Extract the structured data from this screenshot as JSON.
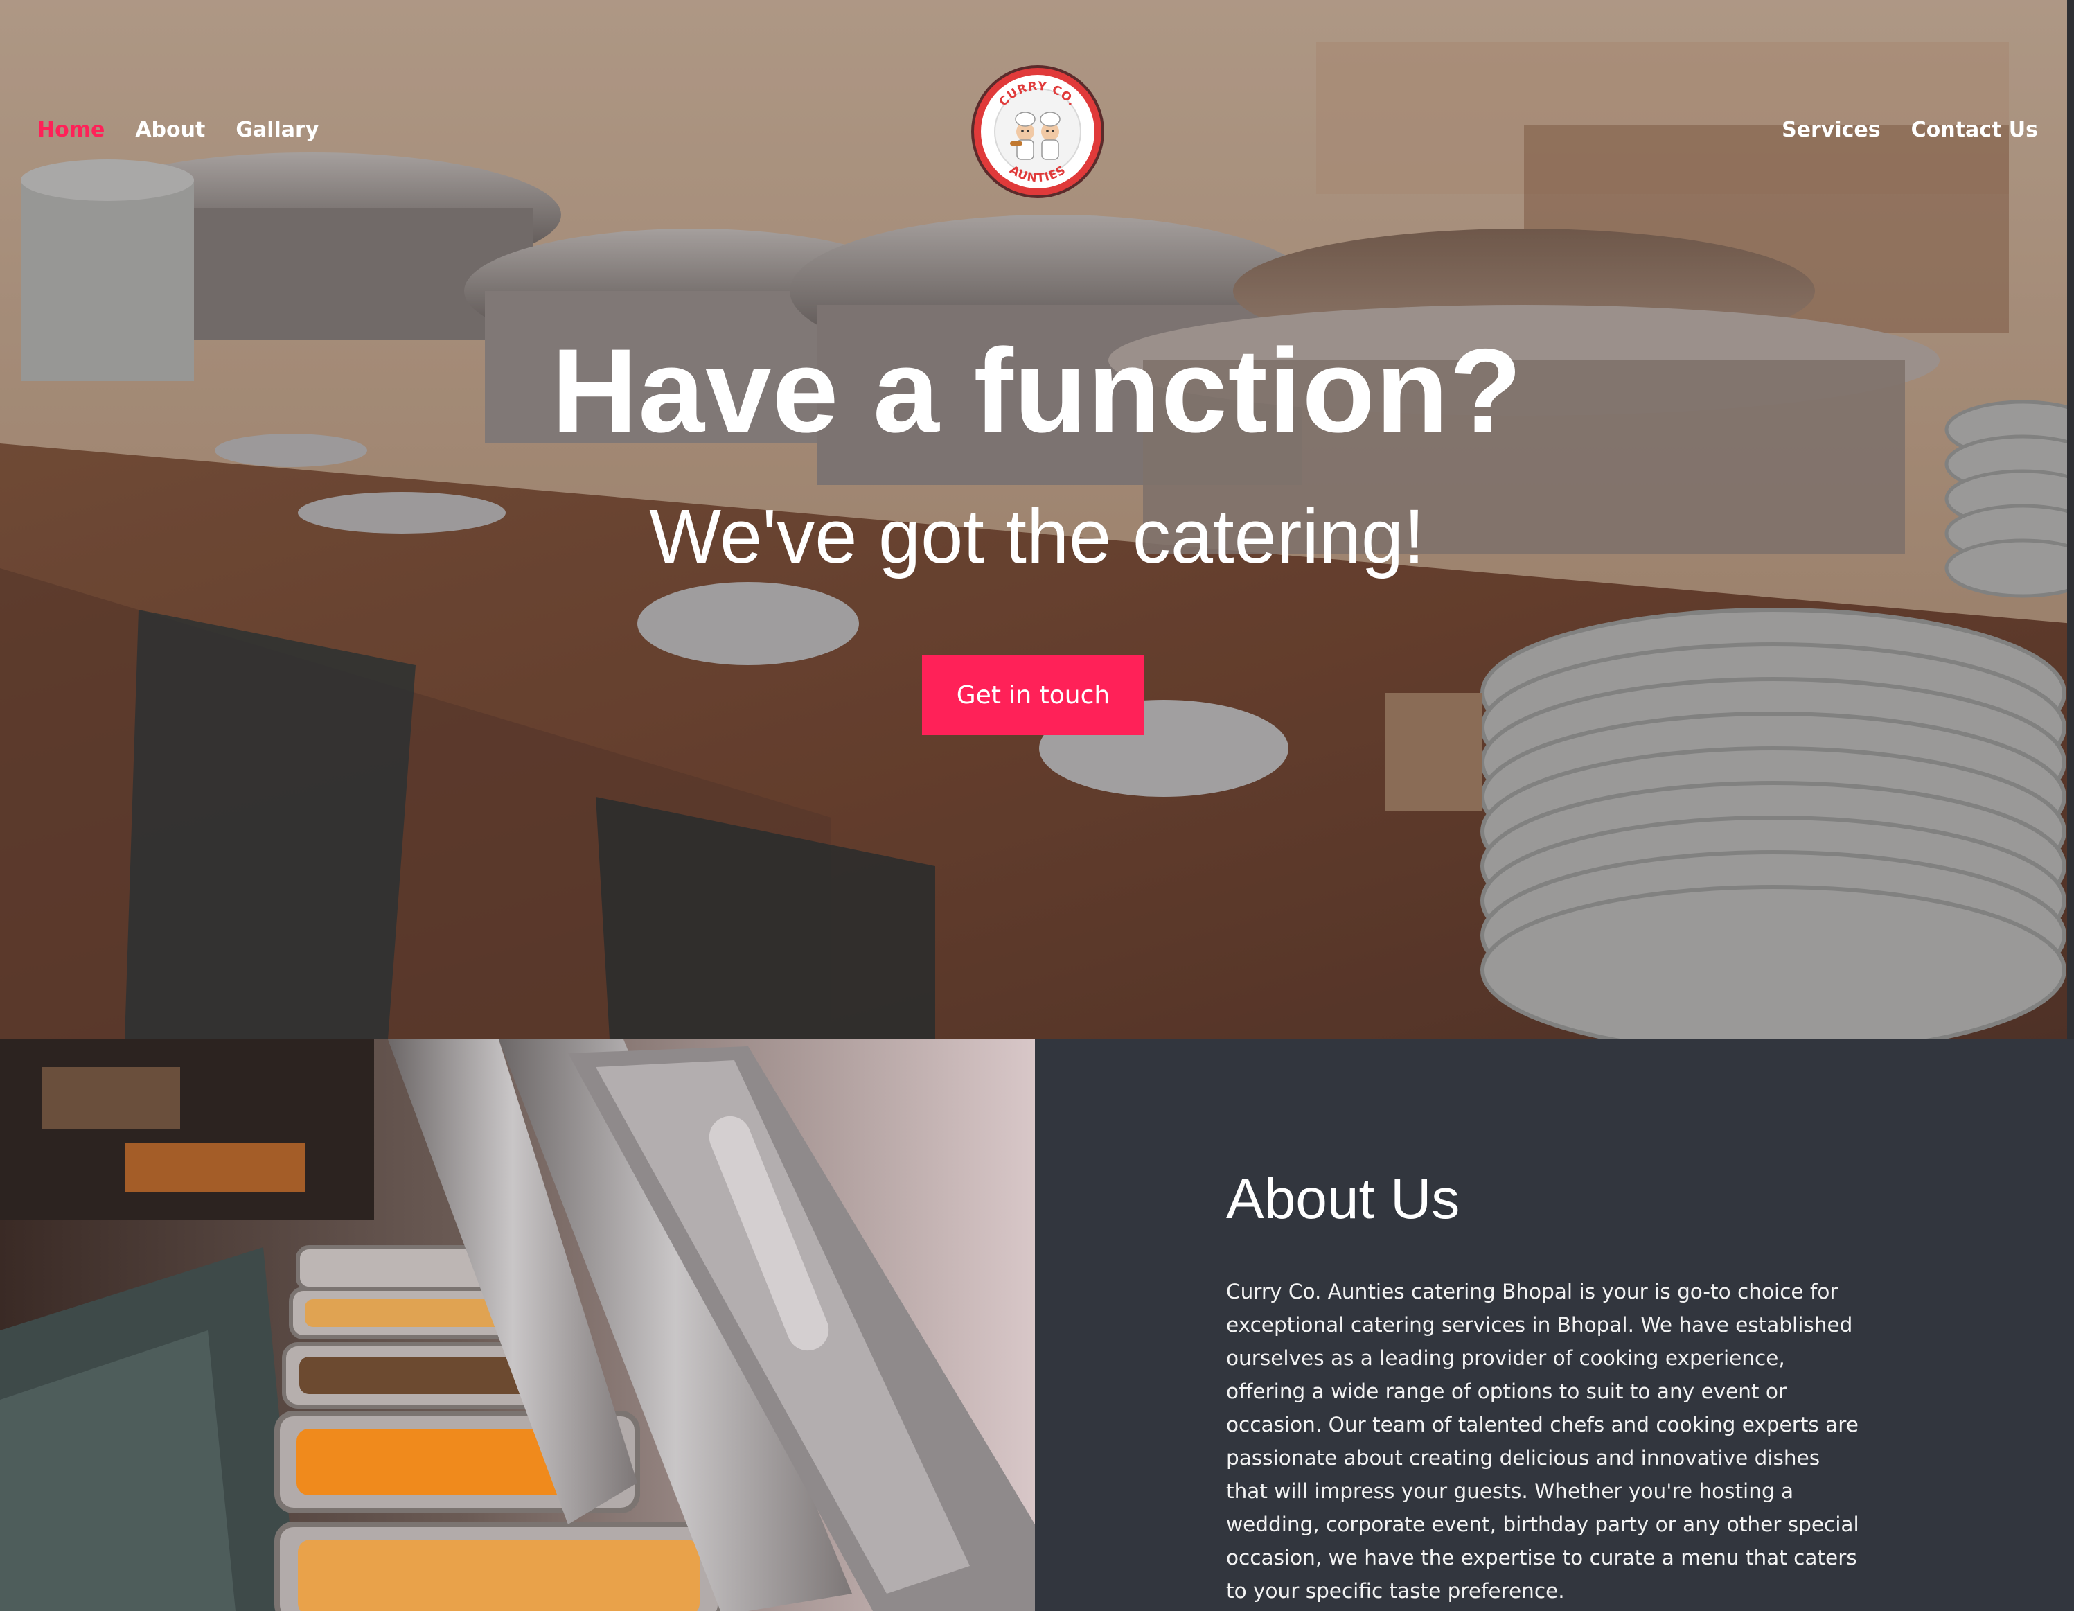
{
  "nav": {
    "left": [
      {
        "label": "Home",
        "active": true
      },
      {
        "label": "About",
        "active": false
      },
      {
        "label": "Gallary",
        "active": false
      }
    ],
    "right": [
      {
        "label": "Services"
      },
      {
        "label": "Contact Us"
      }
    ]
  },
  "logo": {
    "top_text": "CURRY CO.",
    "bottom_text": "AUNTIES",
    "icon": "two-chefs-logo"
  },
  "hero": {
    "title": "Have a function?",
    "subtitle": "We've got the catering!",
    "cta_label": "Get in touch"
  },
  "about": {
    "heading": "About Us",
    "body": "Curry Co. Aunties catering Bhopal is your is go-to choice for exceptional catering services in Bhopal. We have established ourselves as a leading provider of cooking experience, offering a wide range of options to suit to any event or occasion. Our team of talented chefs and cooking experts are passionate about creating delicious and innovative dishes that will impress your guests. Whether you're hosting a wedding, corporate event, birthday party or any other special occasion, we have the expertise to curate a menu that caters to your specific taste preference."
  },
  "colors": {
    "accent": "#ff2158",
    "dark_panel": "#32363e",
    "text": "#ffffff"
  }
}
